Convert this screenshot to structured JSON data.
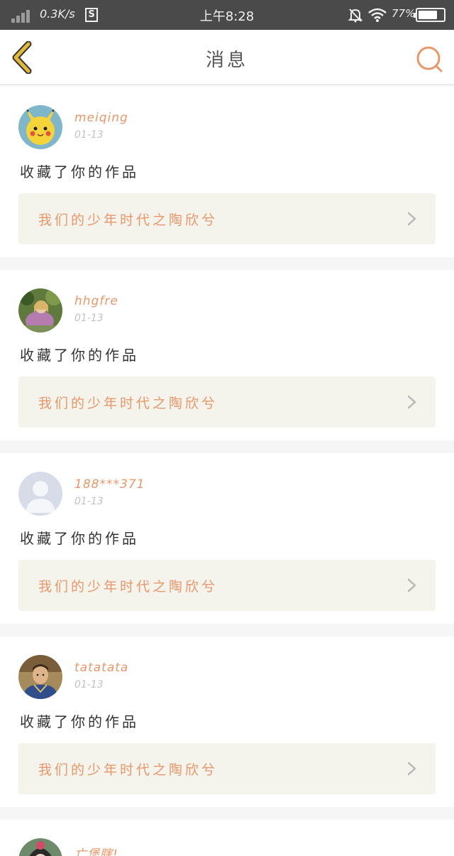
{
  "status_bar": {
    "network_speed": "0.3K/s",
    "s_badge": "S",
    "time": "上午8:28",
    "battery_percent": "77%",
    "battery_level": 0.77
  },
  "header": {
    "title": "消息",
    "back_icon": "chevron-left-icon",
    "search_icon": "search-icon"
  },
  "colors": {
    "accent": "#e8976a",
    "back_chevron": "#e1b93a",
    "card_bg": "#ffffff",
    "work_bg": "#f4f3ec",
    "page_bg": "#f7f6f6"
  },
  "messages": [
    {
      "username": "meiqing",
      "date": "01-13",
      "action": "收藏了你的作品",
      "work_title": "我们的少年时代之陶欣兮",
      "avatar": "pikachu-avatar"
    },
    {
      "username": "hhgfre",
      "date": "01-13",
      "action": "收藏了你的作品",
      "work_title": "我们的少年时代之陶欣兮",
      "avatar": "photo-avatar"
    },
    {
      "username": "188***371",
      "date": "01-13",
      "action": "收藏了你的作品",
      "work_title": "我们的少年时代之陶欣兮",
      "avatar": "default-avatar"
    },
    {
      "username": "tatatata",
      "date": "01-13",
      "action": "收藏了你的作品",
      "work_title": "我们的少年时代之陶欣兮",
      "avatar": "photo-avatar"
    },
    {
      "username": "亡堡瞎!",
      "avatar": "photo-avatar"
    }
  ]
}
